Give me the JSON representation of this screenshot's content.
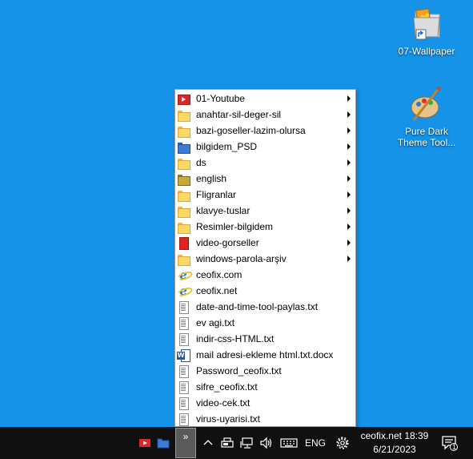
{
  "desktop": {
    "icons": [
      {
        "label": "07-Wallpaper",
        "icon": "folder-shortcut-icon"
      },
      {
        "label": "Pure Dark Theme Tool...",
        "label_line1": "Pure Dark",
        "label_line2": "Theme Tool...",
        "icon": "paint-brush-icon"
      }
    ]
  },
  "menu": {
    "items": [
      {
        "label": "01-Youtube",
        "icon": "youtube-folder-icon",
        "submenu": true
      },
      {
        "label": "anahtar-sil-deger-sil",
        "icon": "folder-icon",
        "submenu": true
      },
      {
        "label": "bazi-goseller-lazim-olursa",
        "icon": "folder-icon",
        "submenu": true
      },
      {
        "label": "bilgidem_PSD",
        "icon": "blue-folder-icon",
        "submenu": true
      },
      {
        "label": "ds",
        "icon": "folder-icon",
        "submenu": true
      },
      {
        "label": "english",
        "icon": "dark-folder-icon",
        "submenu": true
      },
      {
        "label": "Fligranlar",
        "icon": "folder-icon",
        "submenu": true
      },
      {
        "label": "klavye-tuslar",
        "icon": "folder-icon",
        "submenu": true
      },
      {
        "label": "Resimler-bilgidem",
        "icon": "folder-icon",
        "submenu": true
      },
      {
        "label": "video-gorseller",
        "icon": "red-folder-icon",
        "submenu": true
      },
      {
        "label": "windows-parola-arşiv",
        "icon": "folder-icon",
        "submenu": true
      },
      {
        "label": "ceofix.com",
        "icon": "internet-explorer-icon",
        "submenu": false
      },
      {
        "label": "ceofix.net",
        "icon": "internet-explorer-icon",
        "submenu": false
      },
      {
        "label": "date-and-time-tool-paylas.txt",
        "icon": "text-file-icon",
        "submenu": false
      },
      {
        "label": "ev agi.txt",
        "icon": "text-file-icon",
        "submenu": false
      },
      {
        "label": "indir-css-HTML.txt",
        "icon": "text-file-icon",
        "submenu": false
      },
      {
        "label": "mail adresi-ekleme html.txt.docx",
        "icon": "word-document-icon",
        "submenu": false
      },
      {
        "label": "Password_ceofix.txt",
        "icon": "text-file-icon",
        "submenu": false
      },
      {
        "label": "sifre_ceofix.txt",
        "icon": "text-file-icon",
        "submenu": false
      },
      {
        "label": "video-cek.txt",
        "icon": "text-file-icon",
        "submenu": false
      },
      {
        "label": "virus-uyarisi.txt",
        "icon": "text-file-icon",
        "submenu": false
      }
    ]
  },
  "taskbar": {
    "tray_toggle_label": "»",
    "language": "ENG",
    "clock_top": "ceofix.net 18:39",
    "clock_date": "6/21/2023",
    "notification_count": "1"
  },
  "colors": {
    "desktop_bg": "#1493e8",
    "taskbar_bg": "#101010",
    "menu_bg": "#ffffff"
  }
}
